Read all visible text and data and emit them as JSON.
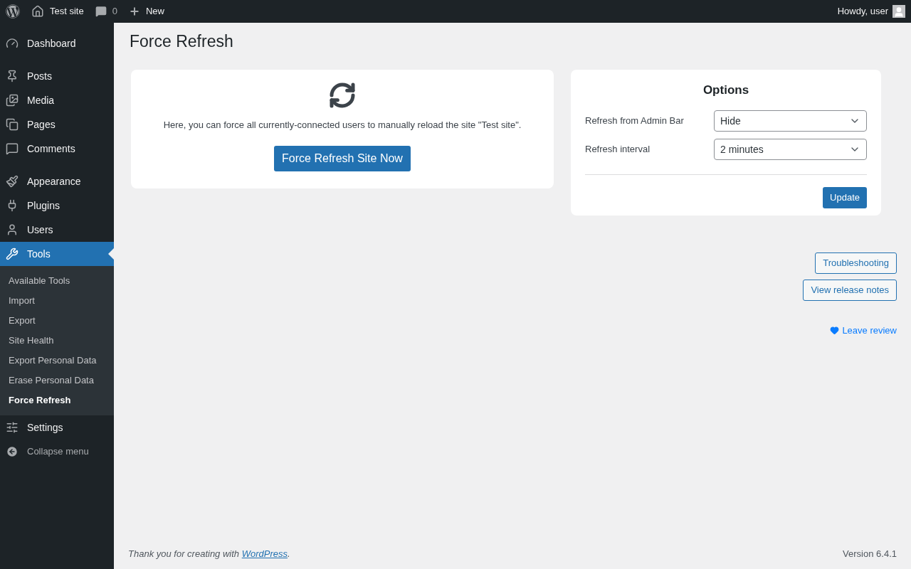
{
  "admin_bar": {
    "site_name": "Test site",
    "comments_count": "0",
    "new_label": "New",
    "greeting": "Howdy, user"
  },
  "sidebar": {
    "sections": [
      [
        {
          "label": "Dashboard",
          "selected": false
        }
      ],
      [
        {
          "label": "Posts",
          "selected": false
        },
        {
          "label": "Media",
          "selected": false
        },
        {
          "label": "Pages",
          "selected": false
        },
        {
          "label": "Comments",
          "selected": false
        }
      ],
      [
        {
          "label": "Appearance",
          "selected": false
        },
        {
          "label": "Plugins",
          "selected": false
        },
        {
          "label": "Users",
          "selected": false
        },
        {
          "label": "Tools",
          "selected": true,
          "children": [
            {
              "label": "Available Tools",
              "selected": false
            },
            {
              "label": "Import",
              "selected": false
            },
            {
              "label": "Export",
              "selected": false
            },
            {
              "label": "Site Health",
              "selected": false
            },
            {
              "label": "Export Personal Data",
              "selected": false
            },
            {
              "label": "Erase Personal Data",
              "selected": false
            },
            {
              "label": "Force Refresh",
              "selected": true
            }
          ]
        },
        {
          "label": "Settings",
          "selected": false
        }
      ]
    ],
    "collapse_label": "Collapse menu"
  },
  "page_title": "Force Refresh",
  "refresh_card": {
    "description": "Here, you can force all currently-connected users to manually reload the site \"Test site\".",
    "button": "Force Refresh Site Now"
  },
  "options_card": {
    "title": "Options",
    "fields": [
      {
        "label": "Refresh from Admin Bar",
        "value": "Hide"
      },
      {
        "label": "Refresh interval",
        "value": "2 minutes"
      }
    ],
    "button": "Update"
  },
  "links": [
    "Troubleshooting",
    "View release notes"
  ],
  "review_link": "Leave review",
  "footer": {
    "credit_prefix": "Thank you for creating with ",
    "credit_link": "WordPress",
    "credit_suffix": ".",
    "version": "Version 6.4.1"
  }
}
